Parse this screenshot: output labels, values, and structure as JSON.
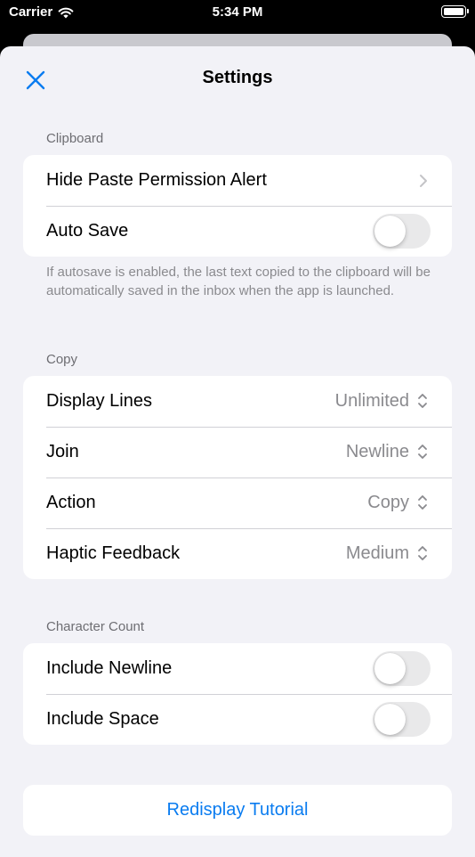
{
  "status_bar": {
    "carrier": "Carrier",
    "time": "5:34 PM",
    "icons": [
      "wifi-icon",
      "battery-icon"
    ]
  },
  "nav": {
    "title": "Settings",
    "close_icon": "close-icon"
  },
  "colors": {
    "accent": "#0a7cf0",
    "background": "#f2f2f7",
    "secondary_text": "#8a8a8e",
    "toggle_off": "#e9e9ea"
  },
  "clipboard": {
    "header": "Clipboard",
    "rows": [
      {
        "label": "Hide Paste Permission Alert",
        "accessory": "chevron-right-icon"
      },
      {
        "label": "Auto Save",
        "toggle": false
      }
    ],
    "footer": "If autosave is enabled, the last text copied to the clipboard will be automatically saved in the inbox when the app is launched."
  },
  "copy": {
    "header": "Copy",
    "rows": [
      {
        "label": "Display Lines",
        "value": "Unlimited",
        "accessory": "up-down-chevron-icon"
      },
      {
        "label": "Join",
        "value": "Newline",
        "accessory": "up-down-chevron-icon"
      },
      {
        "label": "Action",
        "value": "Copy",
        "accessory": "up-down-chevron-icon"
      },
      {
        "label": "Haptic Feedback",
        "value": "Medium",
        "accessory": "up-down-chevron-icon"
      }
    ]
  },
  "character_count": {
    "header": "Character Count",
    "rows": [
      {
        "label": "Include Newline",
        "toggle": false
      },
      {
        "label": "Include Space",
        "toggle": false
      }
    ]
  },
  "tutorial": {
    "label": "Redisplay Tutorial"
  }
}
